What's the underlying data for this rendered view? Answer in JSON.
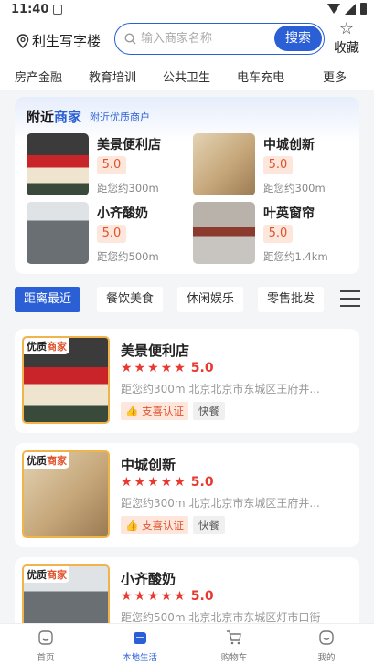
{
  "status_bar": {
    "time": "11:40"
  },
  "header": {
    "location": "利生写字楼",
    "search_placeholder": "输入商家名称",
    "search_button": "搜索",
    "favorite_label": "收藏"
  },
  "categories": [
    "房产金融",
    "教育培训",
    "公共卫生",
    "电车充电",
    "更多"
  ],
  "recommend": {
    "title_part1": "附近",
    "title_part2": "商家",
    "subtitle": "附近优质商户",
    "items": [
      {
        "name": "美景便利店",
        "score": "5.0",
        "distance": "距您约300m"
      },
      {
        "name": "中城创新",
        "score": "5.0",
        "distance": "距您约300m"
      },
      {
        "name": "小齐酸奶",
        "score": "5.0",
        "distance": "距您约500m"
      },
      {
        "name": "叶英窗帘",
        "score": "5.0",
        "distance": "距您约1.4km"
      }
    ]
  },
  "filters": [
    "距离最近",
    "餐饮美食",
    "休闲娱乐",
    "零售批发"
  ],
  "merchants": [
    {
      "badge_a": "优质",
      "badge_b": "商家",
      "name": "美景便利店",
      "stars": "★★★★★",
      "rating": "5.0",
      "info": "距您约300m 北京北京市东城区王府井...",
      "cert": "支喜认证",
      "category": "快餐"
    },
    {
      "badge_a": "优质",
      "badge_b": "商家",
      "name": "中城创新",
      "stars": "★★★★★",
      "rating": "5.0",
      "info": "距您约300m 北京北京市东城区王府井...",
      "cert": "支喜认证",
      "category": "快餐"
    },
    {
      "badge_a": "优质",
      "badge_b": "商家",
      "name": "小齐酸奶",
      "stars": "★★★★★",
      "rating": "5.0",
      "info": "距您约500m 北京北京市东城区灯市口街"
    }
  ],
  "bottom_nav": [
    "首页",
    "本地生活",
    "购物车",
    "我的"
  ],
  "colors": {
    "accent": "#2a5fd6",
    "star": "#e8382f",
    "tag": "#e0532c",
    "badge_border": "#f0b44a"
  }
}
